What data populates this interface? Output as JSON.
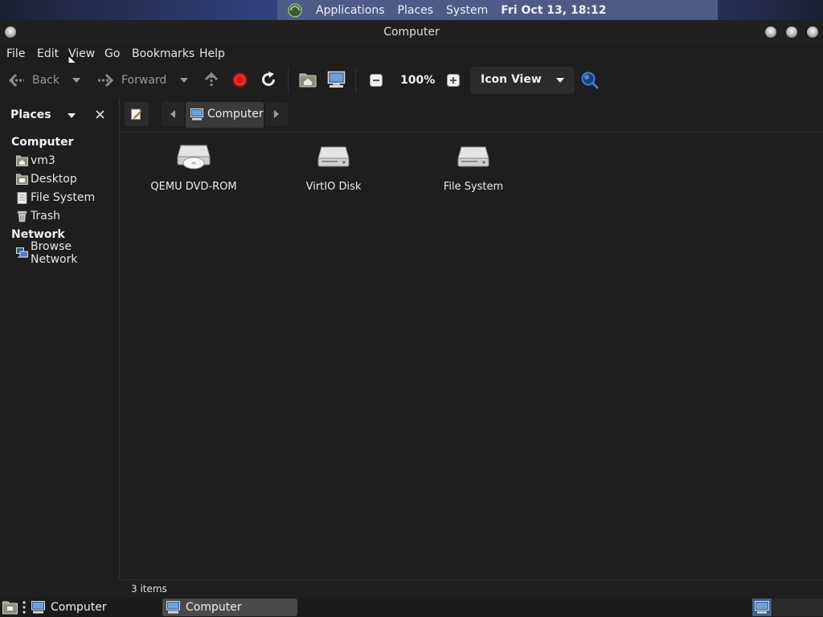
{
  "top_panel": {
    "applications": "Applications",
    "places": "Places",
    "system": "System",
    "clock": "Fri Oct 13, 18:12"
  },
  "window": {
    "title": "Computer"
  },
  "menubar": {
    "file": "File",
    "edit": "Edit",
    "view": "View",
    "go": "Go",
    "bookmarks": "Bookmarks",
    "help": "Help"
  },
  "toolbar": {
    "back": "Back",
    "forward": "Forward",
    "zoom": "100%",
    "view_mode": "Icon View"
  },
  "sidebar": {
    "header": "Places",
    "section_computer": "Computer",
    "items_computer": [
      "vm3",
      "Desktop",
      "File System",
      "Trash"
    ],
    "section_network": "Network",
    "items_network": [
      "Browse Network"
    ]
  },
  "location": {
    "crumb": "Computer"
  },
  "files": [
    "QEMU DVD-ROM",
    "VirtIO Disk",
    "File System"
  ],
  "status": {
    "text": "3 items"
  },
  "bottom_panel": {
    "launcher": "Computer",
    "task": "Computer"
  },
  "colors": {
    "background": "#1e1e1e",
    "panel_accent": "#4d5c86",
    "stop_red": "#cc1a1a",
    "search_blue": "#3f7fd6"
  }
}
